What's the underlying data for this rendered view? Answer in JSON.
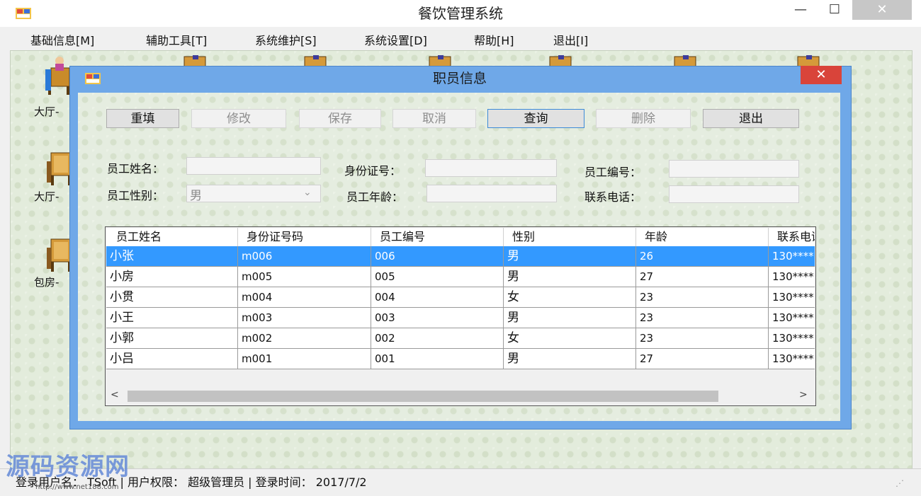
{
  "app": {
    "title": "餐饮管理系统",
    "minimize": "—",
    "maximize": "☐",
    "close": "✕"
  },
  "menu": [
    {
      "label": "基础信息[M]"
    },
    {
      "label": "辅助工具[T]"
    },
    {
      "label": "系统维护[S]"
    },
    {
      "label": "系统设置[D]"
    },
    {
      "label": "帮助[H]"
    },
    {
      "label": "退出[I]"
    }
  ],
  "desktop": {
    "tables": [
      {
        "label": "大厅-"
      },
      {
        "label": "大厅-"
      },
      {
        "label": "包房-"
      }
    ]
  },
  "dialog": {
    "title": "职员信息",
    "close": "✕",
    "buttons": {
      "reset": "重填",
      "edit": "修改",
      "save": "保存",
      "cancel": "取消",
      "query": "查询",
      "delete": "删除",
      "exit": "退出"
    },
    "form": {
      "name_label": "员工姓名：",
      "id_card_label": "身份证号：",
      "emp_no_label": "员工编号：",
      "gender_label": "员工性别：",
      "gender_value": "男",
      "gender_arrow": "⌄",
      "age_label": "员工年龄：",
      "phone_label": "联系电话："
    },
    "grid": {
      "columns": [
        "员工姓名",
        "身份证号码",
        "员工编号",
        "性别",
        "年龄",
        "联系电话"
      ],
      "rows": [
        {
          "name": "小张",
          "id_card": "m006",
          "emp_no": "006",
          "gender": "男",
          "age": "26",
          "phone": "130****"
        },
        {
          "name": "小房",
          "id_card": "m005",
          "emp_no": "005",
          "gender": "男",
          "age": "27",
          "phone": "130****"
        },
        {
          "name": "小贯",
          "id_card": "m004",
          "emp_no": "004",
          "gender": "女",
          "age": "23",
          "phone": "130****"
        },
        {
          "name": "小王",
          "id_card": "m003",
          "emp_no": "003",
          "gender": "男",
          "age": "23",
          "phone": "130****"
        },
        {
          "name": "小郭",
          "id_card": "m002",
          "emp_no": "002",
          "gender": "女",
          "age": "23",
          "phone": "130****"
        },
        {
          "name": "小吕",
          "id_card": "m001",
          "emp_no": "001",
          "gender": "男",
          "age": "27",
          "phone": "130****"
        }
      ],
      "scroll_left": "<",
      "scroll_right": ">"
    }
  },
  "status": {
    "text": "登录用户名：  TSoft  |  用户权限：  超级管理员  |  登录时间：  2017/7/2"
  },
  "watermark": {
    "text": "源码资源网",
    "url": "http://www.net188.com"
  },
  "colors": {
    "accent": "#6fa8e8",
    "selection": "#3399ff",
    "close_red": "#d9443a"
  }
}
